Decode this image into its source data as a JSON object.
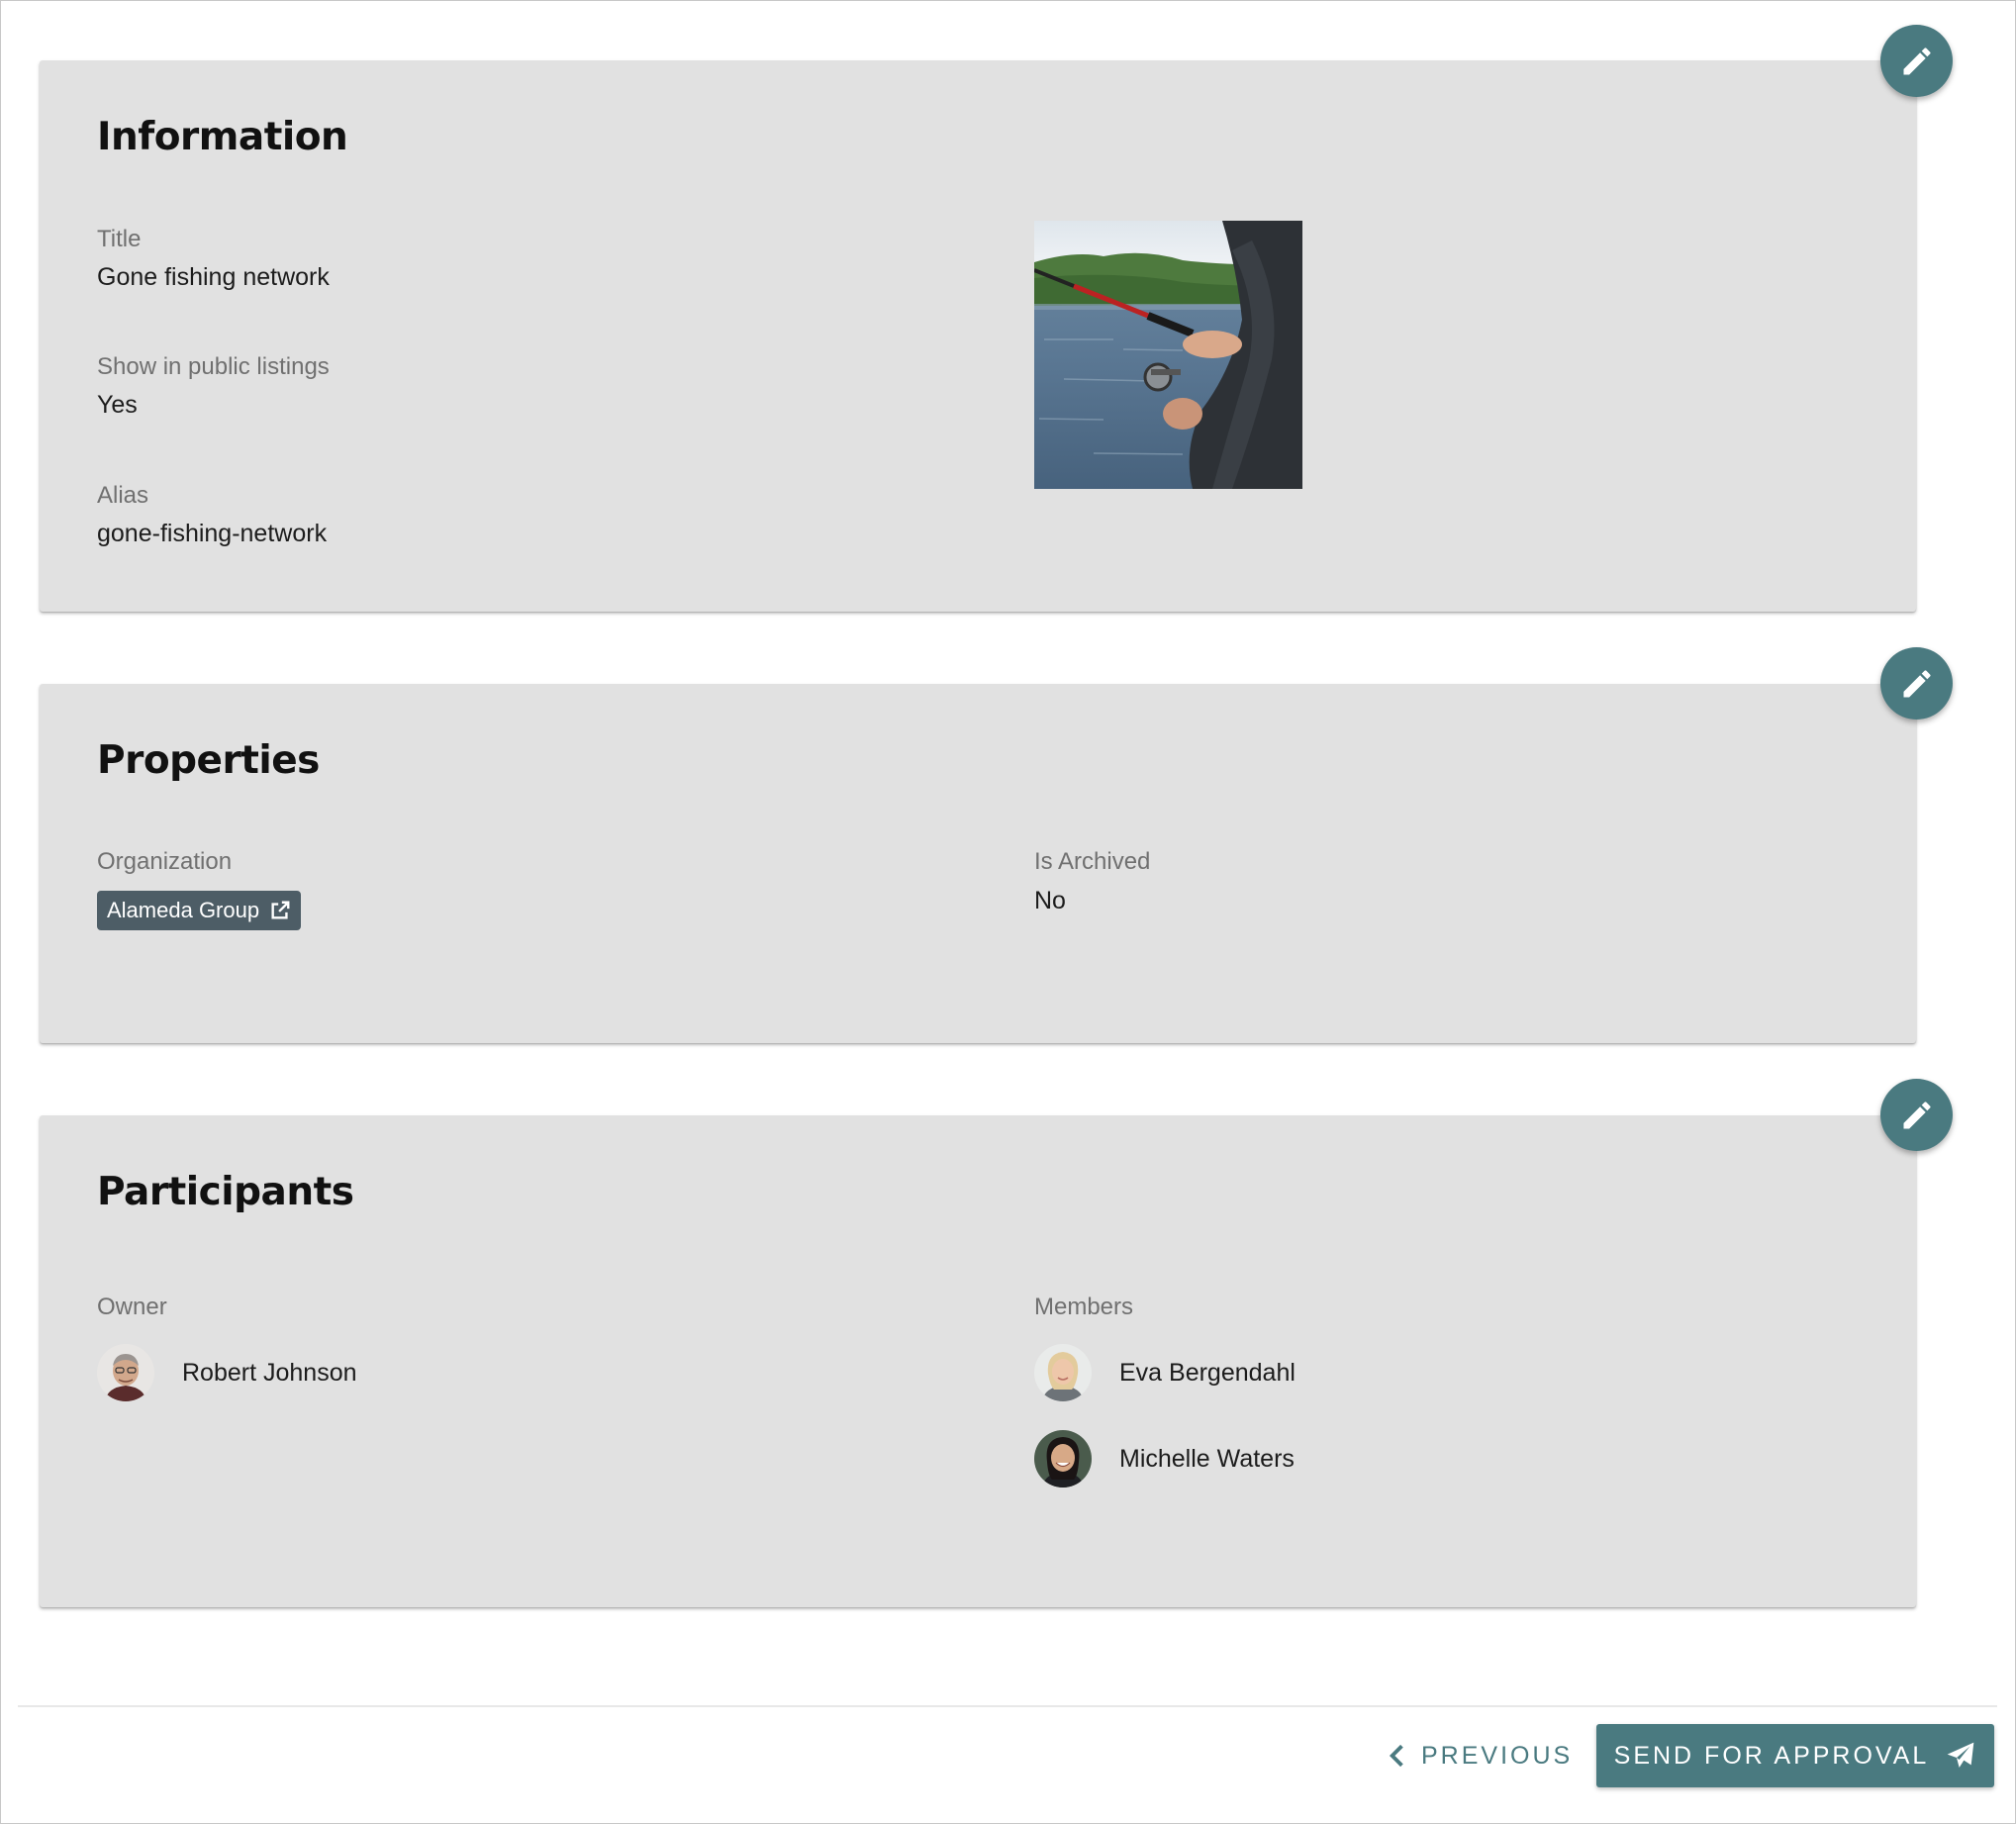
{
  "information": {
    "title": "Information",
    "fields": {
      "title_label": "Title",
      "title_value": "Gone fishing network",
      "public_label": "Show in public listings",
      "public_value": "Yes",
      "alias_label": "Alias",
      "alias_value": "gone-fishing-network"
    },
    "image_icon": "fishing-photo",
    "edit_icon": "pencil-icon"
  },
  "properties": {
    "title": "Properties",
    "organization_label": "Organization",
    "organization_value": "Alameda Group",
    "organization_link_icon": "external-link-icon",
    "archived_label": "Is Archived",
    "archived_value": "No",
    "edit_icon": "pencil-icon"
  },
  "participants": {
    "title": "Participants",
    "owner_label": "Owner",
    "owner": {
      "name": "Robert Johnson",
      "avatar": "robert-johnson-avatar"
    },
    "members_label": "Members",
    "members": [
      {
        "name": "Eva Bergendahl",
        "avatar": "eva-bergendahl-avatar"
      },
      {
        "name": "Michelle Waters",
        "avatar": "michelle-waters-avatar"
      }
    ],
    "edit_icon": "pencil-icon"
  },
  "footer": {
    "previous_label": "PREVIOUS",
    "previous_icon": "chevron-left-icon",
    "send_label": "SEND FOR APPROVAL",
    "send_icon": "paper-plane-icon"
  },
  "colors": {
    "accent": "#4a7a80",
    "card_background": "#e1e1e1",
    "chip_background": "#4d5d66",
    "label_text": "#707070"
  }
}
